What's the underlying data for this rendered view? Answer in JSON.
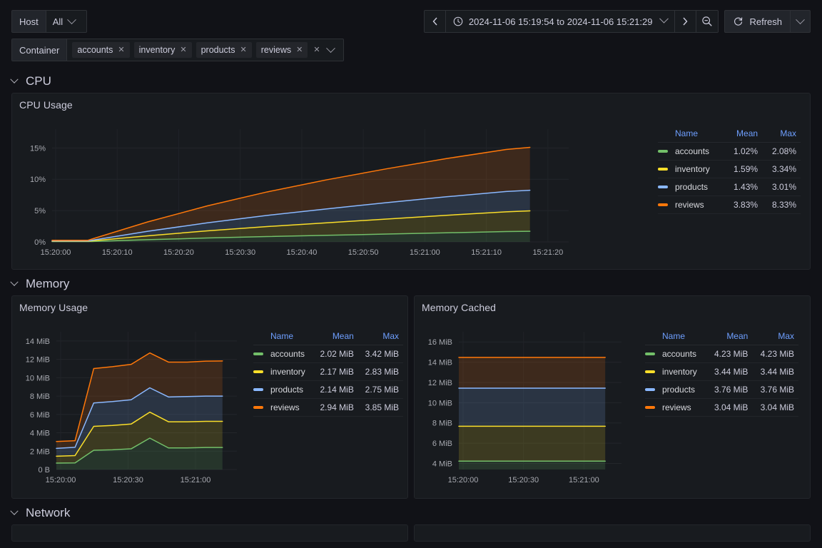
{
  "variables": {
    "host": {
      "label": "Host",
      "value": "All",
      "icon": "chevron-down-icon"
    },
    "container": {
      "label": "Container",
      "values": [
        "accounts",
        "inventory",
        "products",
        "reviews"
      ],
      "remove_icon": "close-icon",
      "clear_icon": "close-icon",
      "expand_icon": "chevron-down-icon"
    }
  },
  "timepicker": {
    "prev_label": "‹",
    "next_label": "›",
    "clock_icon": "clock-icon",
    "range": "2024-11-06 15:19:54 to 2024-11-06 15:21:29",
    "caret_icon": "chevron-down-icon",
    "zoom_out_icon": "zoom-out-icon",
    "refresh_label": "Refresh",
    "refresh_icon": "refresh-icon",
    "refresh_caret_icon": "chevron-down-icon"
  },
  "sections": [
    {
      "title": "CPU",
      "collapse_icon": "chevron-down-icon"
    },
    {
      "title": "Memory",
      "collapse_icon": "chevron-down-icon"
    },
    {
      "title": "Network",
      "collapse_icon": "chevron-down-icon"
    }
  ],
  "legend_headers": {
    "name": "Name",
    "mean": "Mean",
    "max": "Max"
  },
  "colors": {
    "accounts": "#73bf69",
    "inventory": "#fade2a",
    "products": "#8ab8ff",
    "reviews": "#ff780a",
    "panel_bg": "#181b1f",
    "page_bg": "#111217",
    "accent": "#6e9fff",
    "text": "#ccccdc",
    "axis_text": "#a7a9b0"
  },
  "panels": {
    "cpu_usage": {
      "title": "CPU Usage",
      "legend": [
        {
          "name": "accounts",
          "mean": "1.02%",
          "max": "2.08%"
        },
        {
          "name": "inventory",
          "mean": "1.59%",
          "max": "3.34%"
        },
        {
          "name": "products",
          "mean": "1.43%",
          "max": "3.01%"
        },
        {
          "name": "reviews",
          "mean": "3.83%",
          "max": "8.33%"
        }
      ]
    },
    "memory_usage": {
      "title": "Memory Usage",
      "legend": [
        {
          "name": "accounts",
          "mean": "2.02 MiB",
          "max": "3.42 MiB"
        },
        {
          "name": "inventory",
          "mean": "2.17 MiB",
          "max": "2.83 MiB"
        },
        {
          "name": "products",
          "mean": "2.14 MiB",
          "max": "2.75 MiB"
        },
        {
          "name": "reviews",
          "mean": "2.94 MiB",
          "max": "3.85 MiB"
        }
      ]
    },
    "memory_cached": {
      "title": "Memory Cached",
      "legend": [
        {
          "name": "accounts",
          "mean": "4.23 MiB",
          "max": "4.23 MiB"
        },
        {
          "name": "inventory",
          "mean": "3.44 MiB",
          "max": "3.44 MiB"
        },
        {
          "name": "products",
          "mean": "3.76 MiB",
          "max": "3.76 MiB"
        },
        {
          "name": "reviews",
          "mean": "3.04 MiB",
          "max": "3.04 MiB"
        }
      ]
    }
  },
  "chart_data": [
    {
      "id": "cpu_usage",
      "type": "area",
      "stacked": true,
      "title": "CPU Usage",
      "xlabel": "",
      "ylabel": "",
      "ylim": [
        0,
        18
      ],
      "yticks": [
        0,
        5,
        10,
        15
      ],
      "yticklabels": [
        "0%",
        "5%",
        "10%",
        "15%"
      ],
      "xlim": [
        "15:19:54",
        "15:21:29"
      ],
      "xticks": [
        "15:20:00",
        "15:20:10",
        "15:20:20",
        "15:20:30",
        "15:20:40",
        "15:20:50",
        "15:21:00",
        "15:21:10",
        "15:21:20"
      ],
      "grid": true,
      "legend_position": "right-table",
      "x": [
        0,
        6,
        16,
        26,
        36,
        46,
        56,
        66,
        76,
        80
      ],
      "series": [
        {
          "name": "accounts",
          "color": "#73bf69",
          "values": [
            0.05,
            0.05,
            0.35,
            0.62,
            0.85,
            1.05,
            1.25,
            1.45,
            1.65,
            1.7
          ]
        },
        {
          "name": "inventory",
          "color": "#fade2a",
          "values": [
            0.05,
            0.05,
            0.62,
            1.15,
            1.6,
            2.0,
            2.4,
            2.8,
            3.15,
            3.25
          ]
        },
        {
          "name": "products",
          "color": "#8ab8ff",
          "values": [
            0.06,
            0.06,
            0.72,
            1.28,
            1.78,
            2.22,
            2.62,
            2.95,
            3.25,
            3.3
          ]
        },
        {
          "name": "reviews",
          "color": "#ff780a",
          "values": [
            0.1,
            0.1,
            1.5,
            2.7,
            3.75,
            4.65,
            5.4,
            6.1,
            6.7,
            6.85
          ]
        }
      ]
    },
    {
      "id": "memory_usage",
      "type": "area",
      "stacked": true,
      "title": "Memory Usage",
      "xlabel": "",
      "ylabel": "",
      "ylim": [
        0,
        15
      ],
      "yticks": [
        0,
        2,
        4,
        6,
        8,
        10,
        12,
        14
      ],
      "yticklabels": [
        "0 B",
        "2 MiB",
        "4 MiB",
        "6 MiB",
        "8 MiB",
        "10 MiB",
        "12 MiB",
        "14 MiB"
      ],
      "xticks": [
        "15:20:00",
        "15:20:30",
        "15:21:00"
      ],
      "grid": true,
      "legend_position": "right-table",
      "x": [
        0,
        9,
        18,
        27,
        36,
        45,
        54,
        63,
        72,
        80
      ],
      "series": [
        {
          "name": "accounts",
          "color": "#73bf69",
          "values": [
            0.7,
            0.72,
            2.1,
            2.15,
            2.25,
            3.42,
            2.35,
            2.35,
            2.4,
            2.4
          ]
        },
        {
          "name": "inventory",
          "color": "#fade2a",
          "values": [
            0.75,
            0.8,
            2.6,
            2.65,
            2.7,
            2.83,
            2.85,
            2.85,
            2.85,
            2.85
          ]
        },
        {
          "name": "products",
          "color": "#8ab8ff",
          "values": [
            0.85,
            0.9,
            2.55,
            2.6,
            2.65,
            2.65,
            2.7,
            2.75,
            2.75,
            2.75
          ]
        },
        {
          "name": "reviews",
          "color": "#ff780a",
          "values": [
            0.75,
            0.72,
            3.75,
            3.8,
            3.85,
            3.8,
            3.8,
            3.75,
            3.8,
            3.82
          ]
        }
      ]
    },
    {
      "id": "memory_cached",
      "type": "area",
      "stacked": true,
      "title": "Memory Cached",
      "xlabel": "",
      "ylabel": "",
      "ylim": [
        3.4,
        17
      ],
      "yticks": [
        4,
        6,
        8,
        10,
        12,
        14,
        16
      ],
      "yticklabels": [
        "4 MiB",
        "6 MiB",
        "8 MiB",
        "10 MiB",
        "12 MiB",
        "14 MiB",
        "16 MiB"
      ],
      "xticks": [
        "15:20:00",
        "15:20:30",
        "15:21:00"
      ],
      "grid": true,
      "legend_position": "right-table",
      "x": [
        0,
        20,
        40,
        60,
        80
      ],
      "series": [
        {
          "name": "accounts",
          "color": "#73bf69",
          "values": [
            4.23,
            4.23,
            4.23,
            4.23,
            4.23
          ]
        },
        {
          "name": "inventory",
          "color": "#fade2a",
          "values": [
            3.44,
            3.44,
            3.44,
            3.44,
            3.44
          ]
        },
        {
          "name": "products",
          "color": "#8ab8ff",
          "values": [
            3.76,
            3.76,
            3.76,
            3.76,
            3.76
          ]
        },
        {
          "name": "reviews",
          "color": "#ff780a",
          "values": [
            3.04,
            3.04,
            3.04,
            3.04,
            3.04
          ]
        }
      ]
    }
  ]
}
